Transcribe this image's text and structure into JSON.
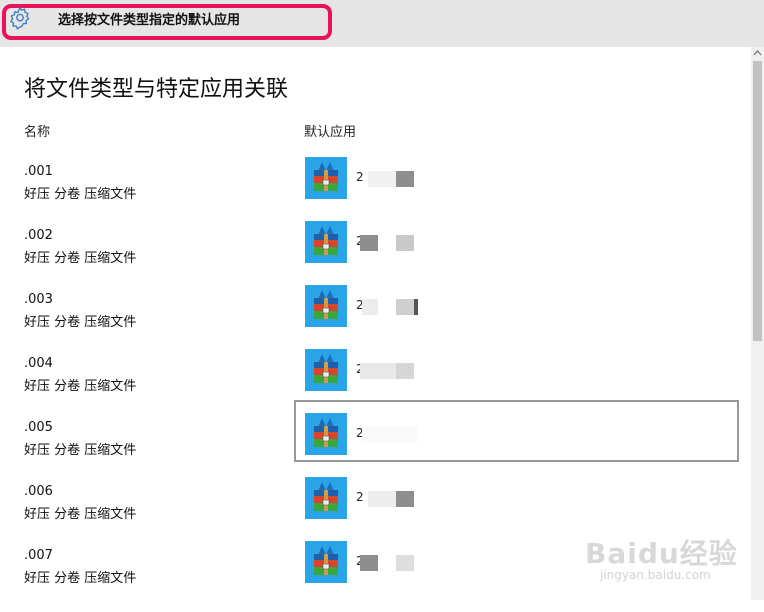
{
  "window": {
    "title": "选择按文件类型指定的默认应用",
    "icon": "gear-icon",
    "highlight_color": "#e8135a"
  },
  "page": {
    "heading": "将文件类型与特定应用关联",
    "col_name": "名称",
    "col_app": "默认应用"
  },
  "rows": [
    {
      "ext": ".001",
      "desc": "好压 分卷 压缩文件",
      "app_prefix": "2"
    },
    {
      "ext": ".002",
      "desc": "好压 分卷 压缩文件",
      "app_prefix": "2"
    },
    {
      "ext": ".003",
      "desc": "好压 分卷 压缩文件",
      "app_prefix": "2"
    },
    {
      "ext": ".004",
      "desc": "好压 分卷 压缩文件",
      "app_prefix": "2"
    },
    {
      "ext": ".005",
      "desc": "好压 分卷 压缩文件",
      "app_prefix": "2"
    },
    {
      "ext": ".006",
      "desc": "好压 分卷 压缩文件",
      "app_prefix": "2"
    },
    {
      "ext": ".007",
      "desc": "好压 分卷 压缩文件",
      "app_prefix": "2"
    }
  ],
  "watermark": {
    "text": "Baidu经验",
    "sub": "jingyan.baidu.com"
  }
}
